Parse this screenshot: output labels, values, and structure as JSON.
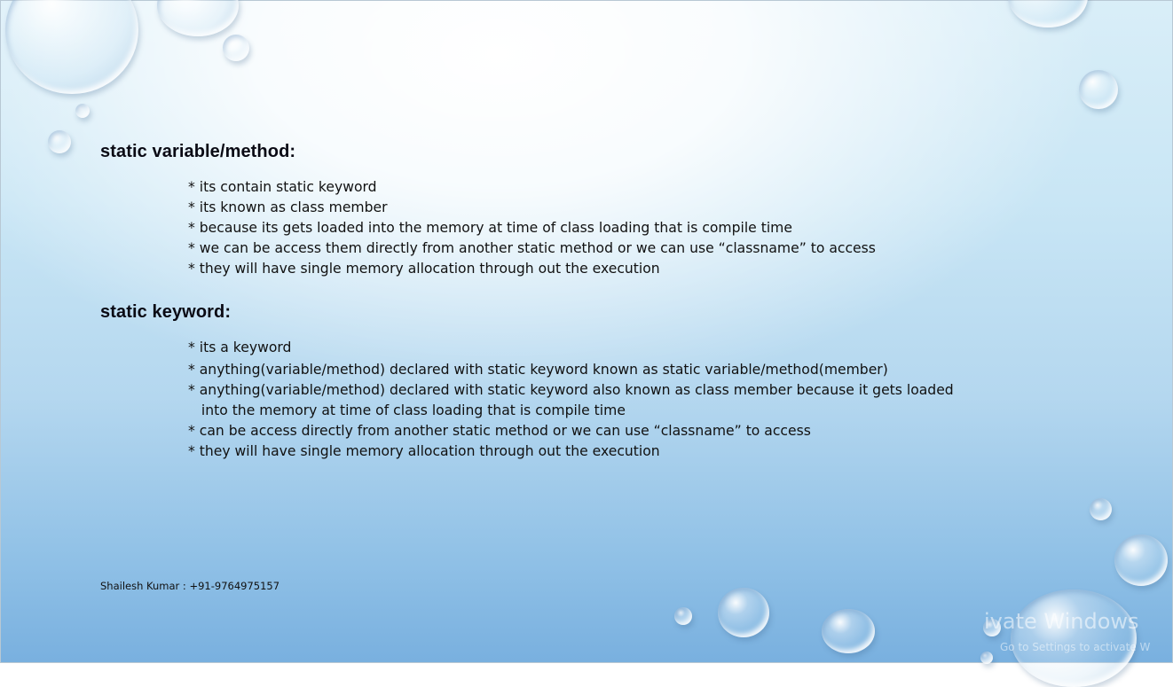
{
  "slide": {
    "section1": {
      "heading": "static variable/method:",
      "bullets": [
        "* its contain static keyword",
        "* its known as class member",
        "* because its gets loaded into the memory at time of class loading that is compile time",
        "* we can be access them directly from another static method or we can use “classname” to access",
        "* they will have single memory allocation through out the execution"
      ]
    },
    "section2": {
      "heading": "static keyword:",
      "bullets": [
        "* its a keyword",
        "* anything(variable/method) declared with static keyword known as static variable/method(member)",
        "* anything(variable/method) declared with static keyword also known as class member because it gets loaded",
        "   into the memory at time of class loading that is compile time",
        "* can be access directly from another static method or we can use “classname” to access",
        "* they will have single memory allocation through out the execution"
      ]
    },
    "footer": "Shailesh Kumar : +91-9764975157"
  },
  "watermark": {
    "line1": "ivate Windows",
    "line2": "Go to Settings to activate W"
  }
}
